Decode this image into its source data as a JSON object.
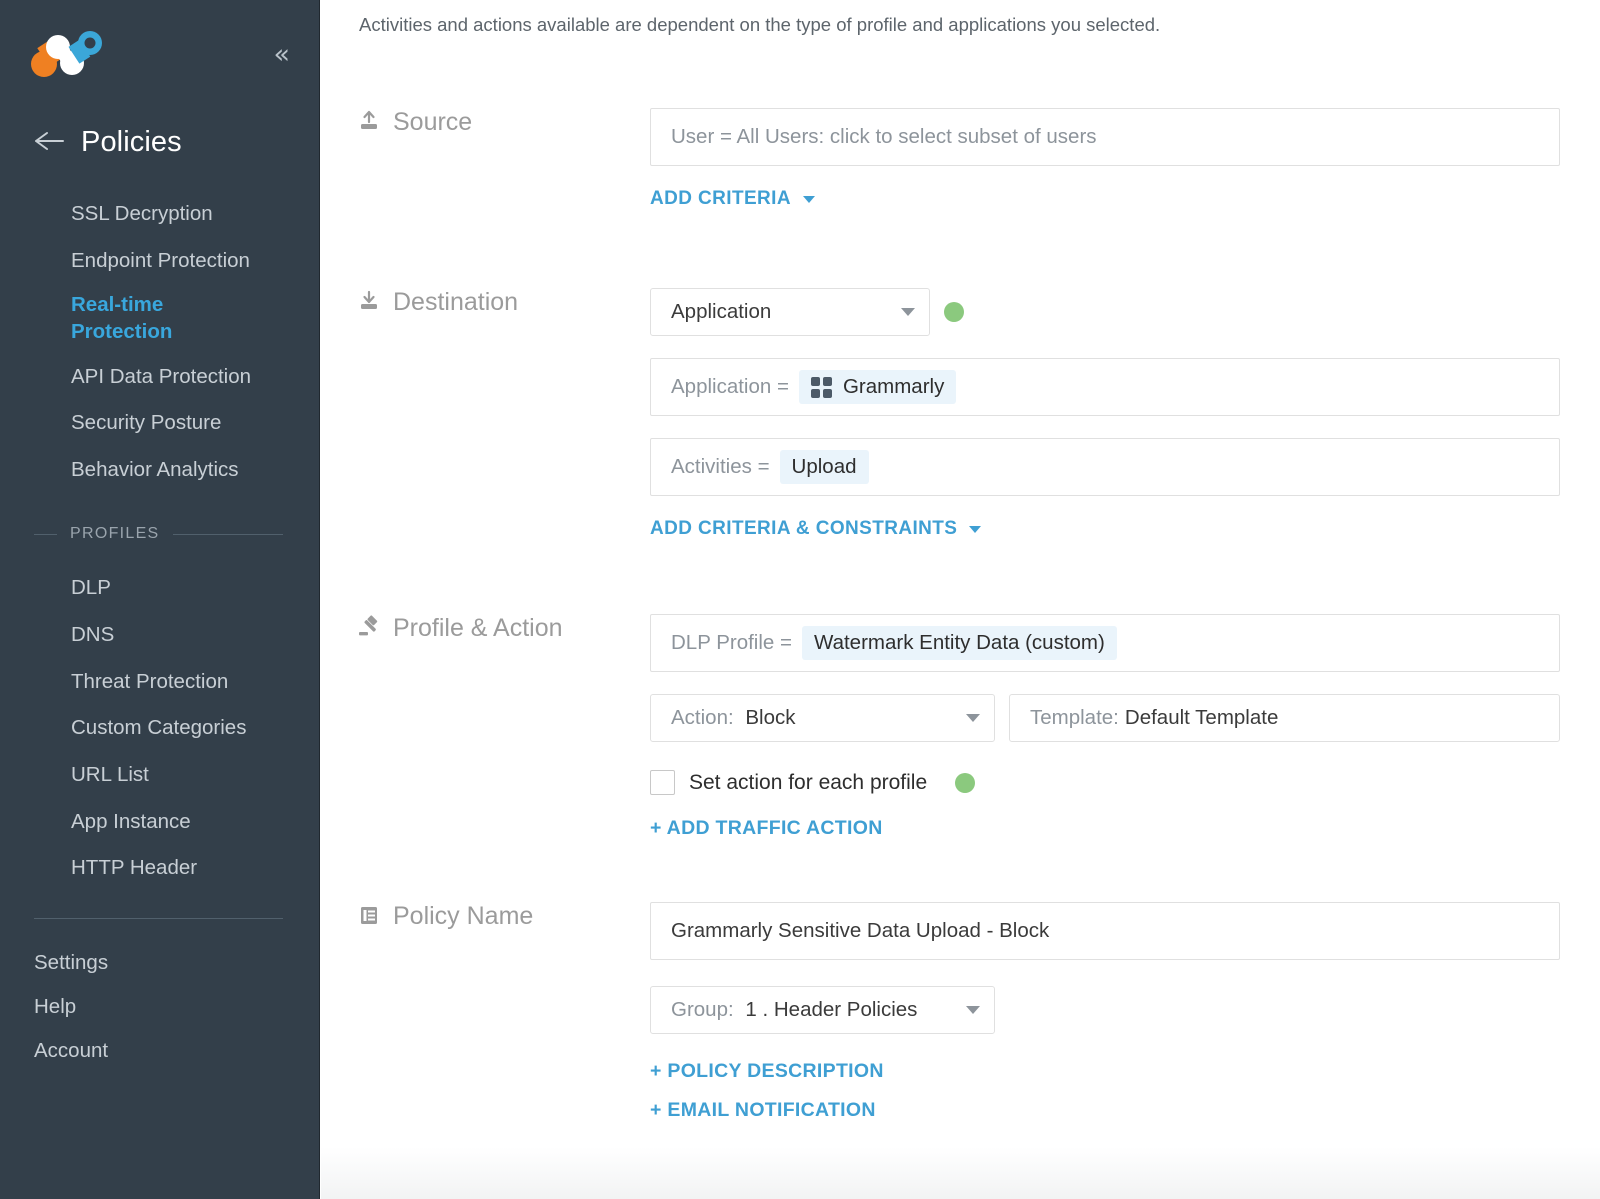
{
  "sidebar": {
    "logo_name": "netskope-logo",
    "collapse_label": "«",
    "page_title": "Policies",
    "nav_items": [
      {
        "label": "SSL Decryption",
        "active": false
      },
      {
        "label": "Endpoint Protection",
        "active": false
      },
      {
        "label": "Real-time Protection",
        "active": true
      },
      {
        "label": "API Data Protection",
        "active": false
      },
      {
        "label": "Security Posture",
        "active": false
      },
      {
        "label": "Behavior Analytics",
        "active": false
      }
    ],
    "profiles_header": "PROFILES",
    "profile_items": [
      {
        "label": "DLP"
      },
      {
        "label": "DNS"
      },
      {
        "label": "Threat Protection"
      },
      {
        "label": "Custom Categories"
      },
      {
        "label": "URL List"
      },
      {
        "label": "App Instance"
      },
      {
        "label": "HTTP Header"
      }
    ],
    "bottom_items": [
      {
        "label": "Settings"
      },
      {
        "label": "Help"
      },
      {
        "label": "Account"
      }
    ]
  },
  "main": {
    "intro": "Activities and actions available are dependent on the type of profile and applications you selected.",
    "source": {
      "title": "Source",
      "icon": "upload-icon",
      "user_field": "User = All Users: click to select subset of users",
      "add_criteria_link": "ADD CRITERIA"
    },
    "destination": {
      "title": "Destination",
      "icon": "download-icon",
      "type_select": "Application",
      "application_label": "Application =",
      "application_value": "Grammarly",
      "application_icon": "app-grid-icon",
      "activities_label": "Activities =",
      "activities_value": "Upload",
      "add_criteria_link": "ADD CRITERIA & CONSTRAINTS"
    },
    "profile_action": {
      "title": "Profile & Action",
      "icon": "gavel-icon",
      "dlp_label": "DLP Profile =",
      "dlp_value": "Watermark Entity Data (custom)",
      "action_label": "Action:",
      "action_value": "Block",
      "template_label": "Template:",
      "template_value": "Default Template",
      "set_action_checkbox_label": "Set action for each profile",
      "add_traffic_action_link": "+ ADD TRAFFIC ACTION"
    },
    "policy_name": {
      "title": "Policy Name",
      "icon": "document-icon",
      "name_value": "Grammarly Sensitive Data Upload - Block",
      "group_label": "Group:",
      "group_value": "1 . Header Policies",
      "policy_description_link": "+ POLICY DESCRIPTION",
      "email_notification_link": "+ EMAIL NOTIFICATION"
    }
  },
  "colors": {
    "sidebar_bg": "#333f4a",
    "accent_blue": "#3f9fd3",
    "active_nav": "#39a7dd",
    "status_green": "#8bc97e",
    "chip_bg": "#eaf4fb"
  }
}
